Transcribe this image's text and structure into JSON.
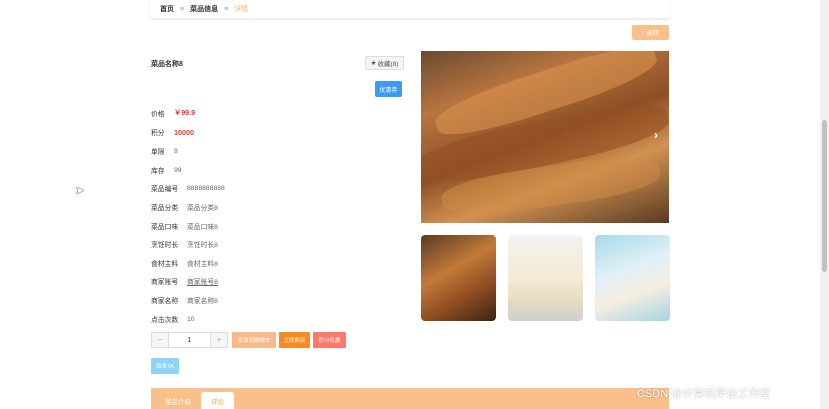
{
  "breadcrumb": {
    "home": "首页",
    "section": "菜品信息",
    "current": "详情",
    "separator": "≡"
  },
  "back_button": {
    "label": "返回",
    "icon": "chevron-left-icon"
  },
  "product": {
    "name": "菜品名称8",
    "collect_label": "收藏(8)",
    "coupon_label": "优惠券"
  },
  "info": [
    {
      "label": "价格",
      "value": "￥99.9"
    },
    {
      "label": "积分",
      "value": "10000"
    },
    {
      "label": "单限",
      "value": "8"
    },
    {
      "label": "库存",
      "value": "99"
    },
    {
      "label": "菜品编号",
      "value": "8888888888"
    },
    {
      "label": "菜品分类",
      "value": "菜品分类8"
    },
    {
      "label": "菜品口味",
      "value": "菜品口味8"
    },
    {
      "label": "烹饪时长",
      "value": "烹饪时长8"
    },
    {
      "label": "食材主料",
      "value": "食材主料8"
    },
    {
      "label": "商家账号",
      "value": "商家账号8"
    },
    {
      "label": "商家名称",
      "value": "商家名称8"
    },
    {
      "label": "点击次数",
      "value": "10"
    }
  ],
  "quantity": {
    "minus": "−",
    "value": "1",
    "plus": "+"
  },
  "actions": {
    "add_cart": "添加到购物车",
    "buy_now": "立即购买",
    "points_redeem": "积分兑换",
    "chat": "联系TA"
  },
  "gallery": {
    "next_arrow": "›"
  },
  "tabs": [
    {
      "label": "菜品介绍"
    },
    {
      "label": "评论"
    }
  ],
  "watermark": "CSDN @计算机毕设工作室",
  "colors": {
    "accent": "#f9c08b",
    "price": "#e53935",
    "coupon": "#3a9bf0",
    "buy": "#f98a1f",
    "points": "#f77a6a",
    "chat": "#8dd4f7"
  }
}
